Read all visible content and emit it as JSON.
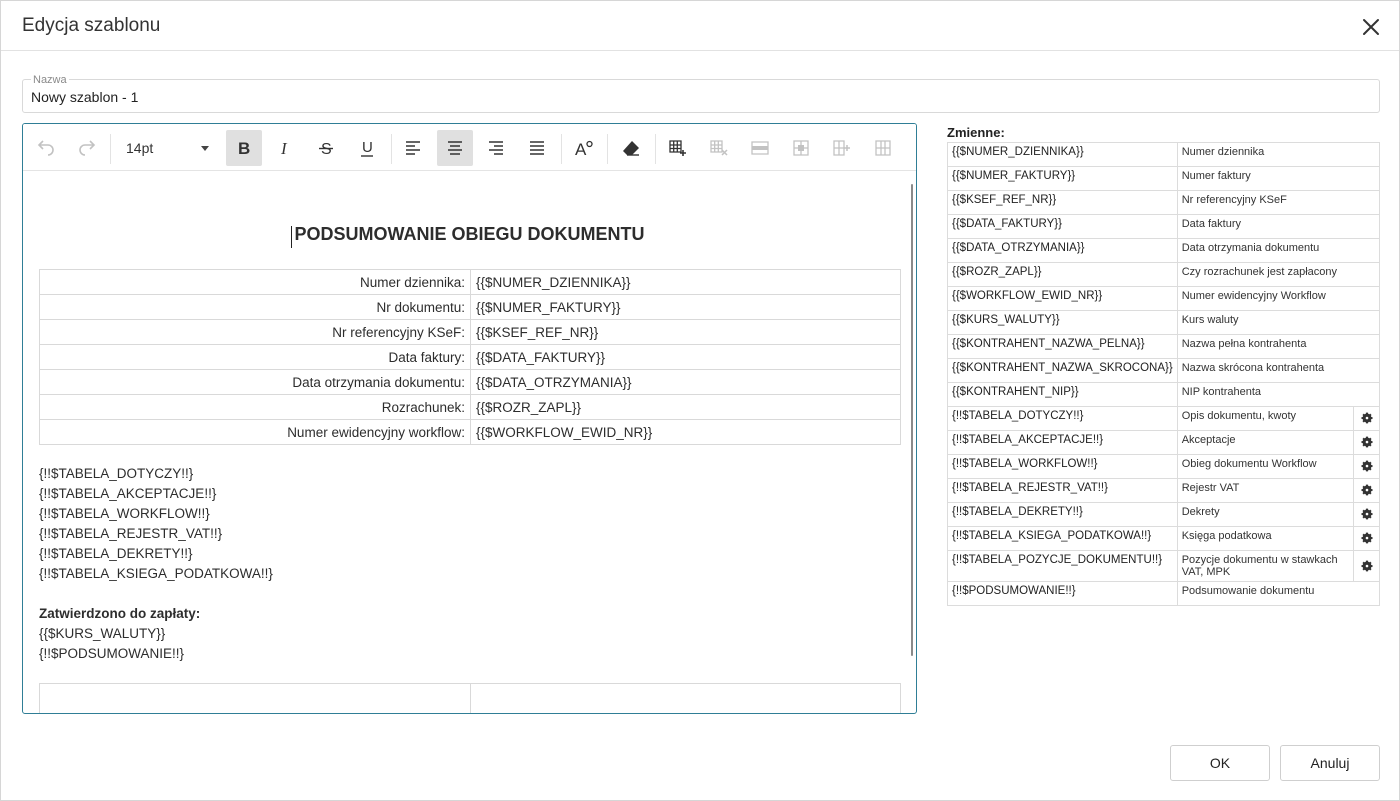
{
  "dialog": {
    "title": "Edycja szablonu"
  },
  "name_field": {
    "label": "Nazwa",
    "value": "Nowy szablon - 1"
  },
  "toolbar": {
    "font_size": "14pt"
  },
  "document": {
    "heading": "PODSUMOWANIE OBIEGU DOKUMENTU",
    "rows": [
      {
        "label": "Numer dziennika:",
        "value": "{{$NUMER_DZIENNIKA}}"
      },
      {
        "label": "Nr dokumentu:",
        "value": "{{$NUMER_FAKTURY}}"
      },
      {
        "label": "Nr referencyjny KSeF:",
        "value": "{{$KSEF_REF_NR}}"
      },
      {
        "label": "Data faktury:",
        "value": "{{$DATA_FAKTURY}}"
      },
      {
        "label": "Data otrzymania dokumentu:",
        "value": "{{$DATA_OTRZYMANIA}}"
      },
      {
        "label": "Rozrachunek:",
        "value": "{{$ROZR_ZAPL}}"
      },
      {
        "label": "Numer ewidencyjny workflow:",
        "value": "{{$WORKFLOW_EWID_NR}}"
      }
    ],
    "lines": [
      "{!!$TABELA_DOTYCZY!!}",
      "{!!$TABELA_AKCEPTACJE!!}",
      "{!!$TABELA_WORKFLOW!!}",
      "{!!$TABELA_REJESTR_VAT!!}",
      "{!!$TABELA_DEKRETY!!}",
      "{!!$TABELA_KSIEGA_PODATKOWA!!}"
    ],
    "approved_label": "Zatwierdzono do zapłaty:",
    "footer_lines": [
      "{{$KURS_WALUTY}}",
      "{!!$PODSUMOWANIE!!}"
    ]
  },
  "variables": {
    "title": "Zmienne:",
    "items": [
      {
        "name": "{{$NUMER_DZIENNIKA}}",
        "desc": "Numer dziennika",
        "gear": false
      },
      {
        "name": "{{$NUMER_FAKTURY}}",
        "desc": "Numer faktury",
        "gear": false
      },
      {
        "name": "{{$KSEF_REF_NR}}",
        "desc": "Nr referencyjny KSeF",
        "gear": false
      },
      {
        "name": "{{$DATA_FAKTURY}}",
        "desc": "Data faktury",
        "gear": false
      },
      {
        "name": "{{$DATA_OTRZYMANIA}}",
        "desc": "Data otrzymania dokumentu",
        "gear": false
      },
      {
        "name": "{{$ROZR_ZAPL}}",
        "desc": "Czy rozrachunek jest zapłacony",
        "gear": false
      },
      {
        "name": "{{$WORKFLOW_EWID_NR}}",
        "desc": "Numer ewidencyjny Workflow",
        "gear": false
      },
      {
        "name": "{{$KURS_WALUTY}}",
        "desc": "Kurs waluty",
        "gear": false
      },
      {
        "name": "{{$KONTRAHENT_NAZWA_PELNA}}",
        "desc": "Nazwa pełna kontrahenta",
        "gear": false
      },
      {
        "name": "{{$KONTRAHENT_NAZWA_SKROCONA}}",
        "desc": "Nazwa skrócona kontrahenta",
        "gear": false
      },
      {
        "name": "{{$KONTRAHENT_NIP}}",
        "desc": "NIP kontrahenta",
        "gear": false
      },
      {
        "name": "{!!$TABELA_DOTYCZY!!}",
        "desc": "Opis dokumentu, kwoty",
        "gear": true
      },
      {
        "name": "{!!$TABELA_AKCEPTACJE!!}",
        "desc": "Akceptacje",
        "gear": true
      },
      {
        "name": "{!!$TABELA_WORKFLOW!!}",
        "desc": "Obieg dokumentu Workflow",
        "gear": true
      },
      {
        "name": "{!!$TABELA_REJESTR_VAT!!}",
        "desc": "Rejestr VAT",
        "gear": true
      },
      {
        "name": "{!!$TABELA_DEKRETY!!}",
        "desc": "Dekrety",
        "gear": true
      },
      {
        "name": "{!!$TABELA_KSIEGA_PODATKOWA!!}",
        "desc": "Księga podatkowa",
        "gear": true
      },
      {
        "name": "{!!$TABELA_POZYCJE_DOKUMENTU!!}",
        "desc": "Pozycje dokumentu w stawkach VAT, MPK",
        "gear": true
      },
      {
        "name": "{!!$PODSUMOWANIE!!}",
        "desc": "Podsumowanie dokumentu",
        "gear": false
      }
    ]
  },
  "buttons": {
    "ok": "OK",
    "cancel": "Anuluj"
  }
}
